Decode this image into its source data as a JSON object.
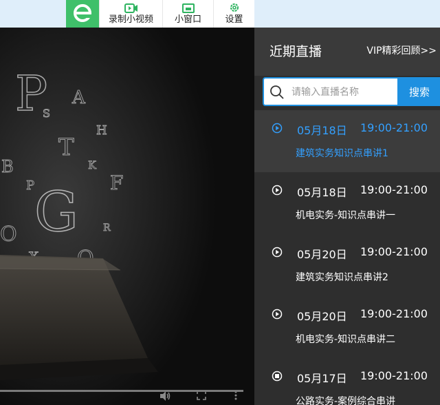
{
  "toolbar": {
    "record_label": "录制小视频",
    "mini_window_label": "小窗口",
    "settings_label": "设置"
  },
  "panel": {
    "title": "近期直播",
    "vip_link": "VIP精彩回顾>>",
    "search": {
      "placeholder": "请输入直播名称",
      "value": "",
      "button_label": "搜索"
    },
    "items": [
      {
        "date": "05月18日",
        "time": "19:00-21:00",
        "name": "建筑实务知识点串讲1",
        "active": true
      },
      {
        "date": "05月18日",
        "time": "19:00-21:00",
        "name": "机电实务-知识点串讲一",
        "active": false
      },
      {
        "date": "05月20日",
        "time": "19:00-21:00",
        "name": "建筑实务知识点串讲2",
        "active": false
      },
      {
        "date": "05月20日",
        "time": "19:00-21:00",
        "name": "机电实务-知识点串讲二",
        "active": false
      },
      {
        "date": "05月17日",
        "time": "19:00-21:00",
        "name": "公路实务-案例综合串讲",
        "active": false
      }
    ]
  },
  "video": {
    "letters": [
      "P",
      "A",
      "S",
      "H",
      "T",
      "B",
      "G",
      "F",
      "Q",
      "X",
      "K",
      "R",
      "P",
      "O"
    ]
  },
  "colors": {
    "accent": "#1e90e0",
    "active_text": "#33a0ff",
    "logo_green": "#3fc06a",
    "topbar_bg": "#dfeefa"
  }
}
